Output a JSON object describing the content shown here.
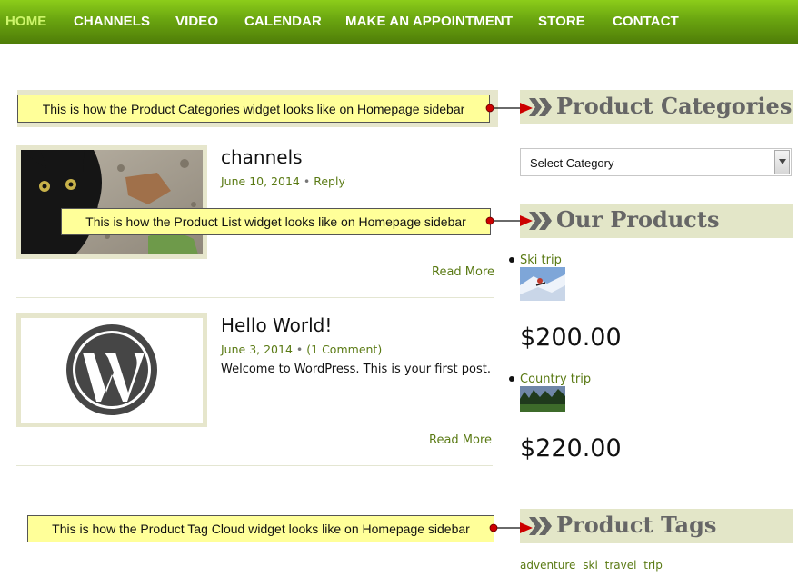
{
  "nav": {
    "items": [
      "HOME",
      "CHANNELS",
      "VIDEO",
      "CALENDAR",
      "MAKE AN APPOINTMENT",
      "STORE",
      "CONTACT"
    ],
    "active": "HOME"
  },
  "posts": [
    {
      "title": "channels",
      "date": "June 10, 2014",
      "comment_link": "Reply",
      "excerpt": "",
      "read_more": "Read More",
      "image": "black-kitten-photo"
    },
    {
      "title": "Hello World!",
      "date": "June 3, 2014",
      "comment_link": "(1 Comment)",
      "excerpt": "Welcome to WordPress. This is your first post.",
      "read_more": "Read More",
      "image": "wordpress-logo"
    }
  ],
  "sidebar": {
    "categories": {
      "title": "Product Categories",
      "select_value": "Select Category"
    },
    "products": {
      "title": "Our Products",
      "items": [
        {
          "name": "Ski trip",
          "price": "$200.00",
          "image": "skier-photo"
        },
        {
          "name": "Country trip",
          "price": "$220.00",
          "image": "forest-photo"
        }
      ]
    },
    "tags": {
      "title": "Product Tags",
      "items": [
        "adventure",
        "ski",
        "travel",
        "trip"
      ]
    }
  },
  "annotations": [
    "This is how the Product Categories widget looks like on Homepage sidebar",
    "This is how the Product List widget looks like on Homepage sidebar",
    "This is how the Product Tag Cloud widget looks like on Homepage sidebar"
  ],
  "colors": {
    "nav_top": "#8ccd1a",
    "nav_bottom": "#4f7d08",
    "active_nav": "#cdf56a",
    "link": "#5a7a14",
    "widget_header_bg": "#e3e6c8",
    "note_bg": "#ffff99",
    "arrow": "#cc0000"
  }
}
